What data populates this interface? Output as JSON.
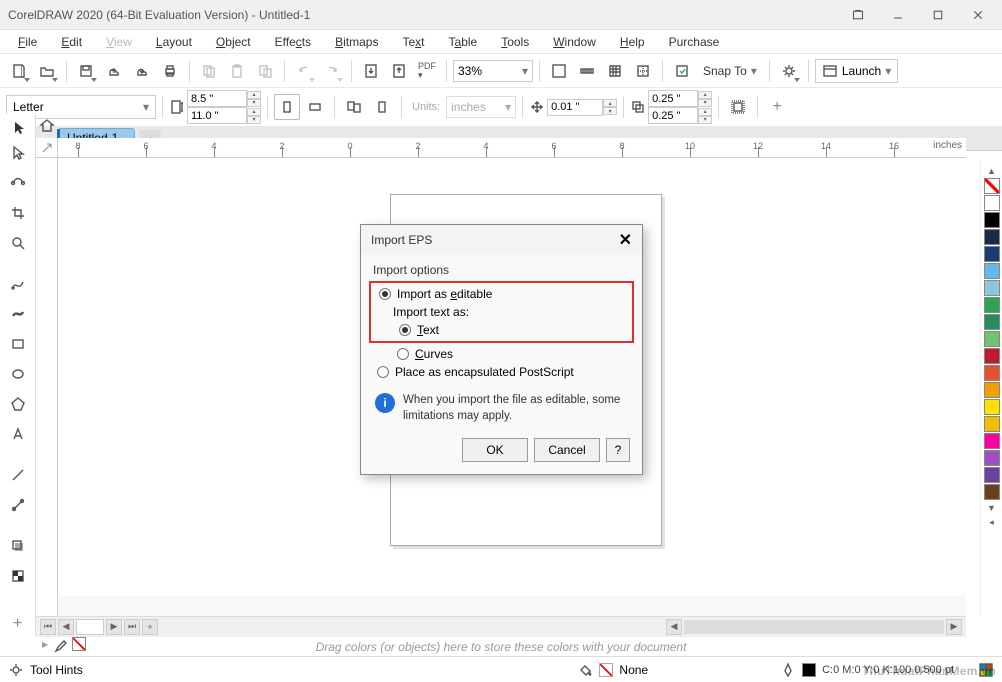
{
  "titlebar": {
    "title": "CorelDRAW 2020 (64-Bit Evaluation Version) - Untitled-1"
  },
  "menubar": {
    "items": [
      "File",
      "Edit",
      "View",
      "Layout",
      "Object",
      "Effects",
      "Bitmaps",
      "Text",
      "Table",
      "Tools",
      "Window",
      "Help",
      "Purchase"
    ]
  },
  "toolbar1": {
    "zoom_value": "33%",
    "snap_label": "Snap To",
    "launch_label": "Launch"
  },
  "propbar": {
    "page_preset": "Letter",
    "width": "8.5 \"",
    "height": "11.0 \"",
    "units_label": "Units:",
    "units_value": "inches",
    "nudge": "0.01 \"",
    "dup_x": "0.25 \"",
    "dup_y": "0.25 \""
  },
  "doc_tab": {
    "label": "Untitled-1"
  },
  "ruler": {
    "units_label": "inches",
    "h_labels": [
      "8",
      "6",
      "4",
      "2",
      "0",
      "2",
      "4",
      "6",
      "8",
      "10",
      "12",
      "14",
      "16"
    ]
  },
  "dialog": {
    "title": "Import EPS",
    "group_label": "Import options",
    "opt_editable": "Import as editable",
    "sub_label": "Import text as:",
    "opt_text": "Text",
    "opt_curves": "Curves",
    "opt_encap": "Place as encapsulated PostScript",
    "info": "When you import the file as editable, some limitations may apply.",
    "btn_ok": "OK",
    "btn_cancel": "Cancel",
    "btn_help": "?"
  },
  "color_store_hint": "Drag colors (or objects) here to store these colors with your document",
  "statusbar": {
    "hints_label": "Tool Hints",
    "fill_label": "None",
    "cmyk": "C:0 M:0 Y:0 K:100  0.500 pt"
  },
  "palette_colors": [
    "#ffffff",
    "#000000",
    "#1a2a4a",
    "#1a3a7a",
    "#67b7e8",
    "#88c8e0",
    "#2aa650",
    "#2a8a60",
    "#73c070",
    "#c01a2a",
    "#e85030",
    "#f0a000",
    "#ffe000",
    "#f0c000",
    "#ff00a0",
    "#a050c0",
    "#7040a0",
    "#6a4020"
  ],
  "watermark": "ThuThuatPhanMem.vn"
}
